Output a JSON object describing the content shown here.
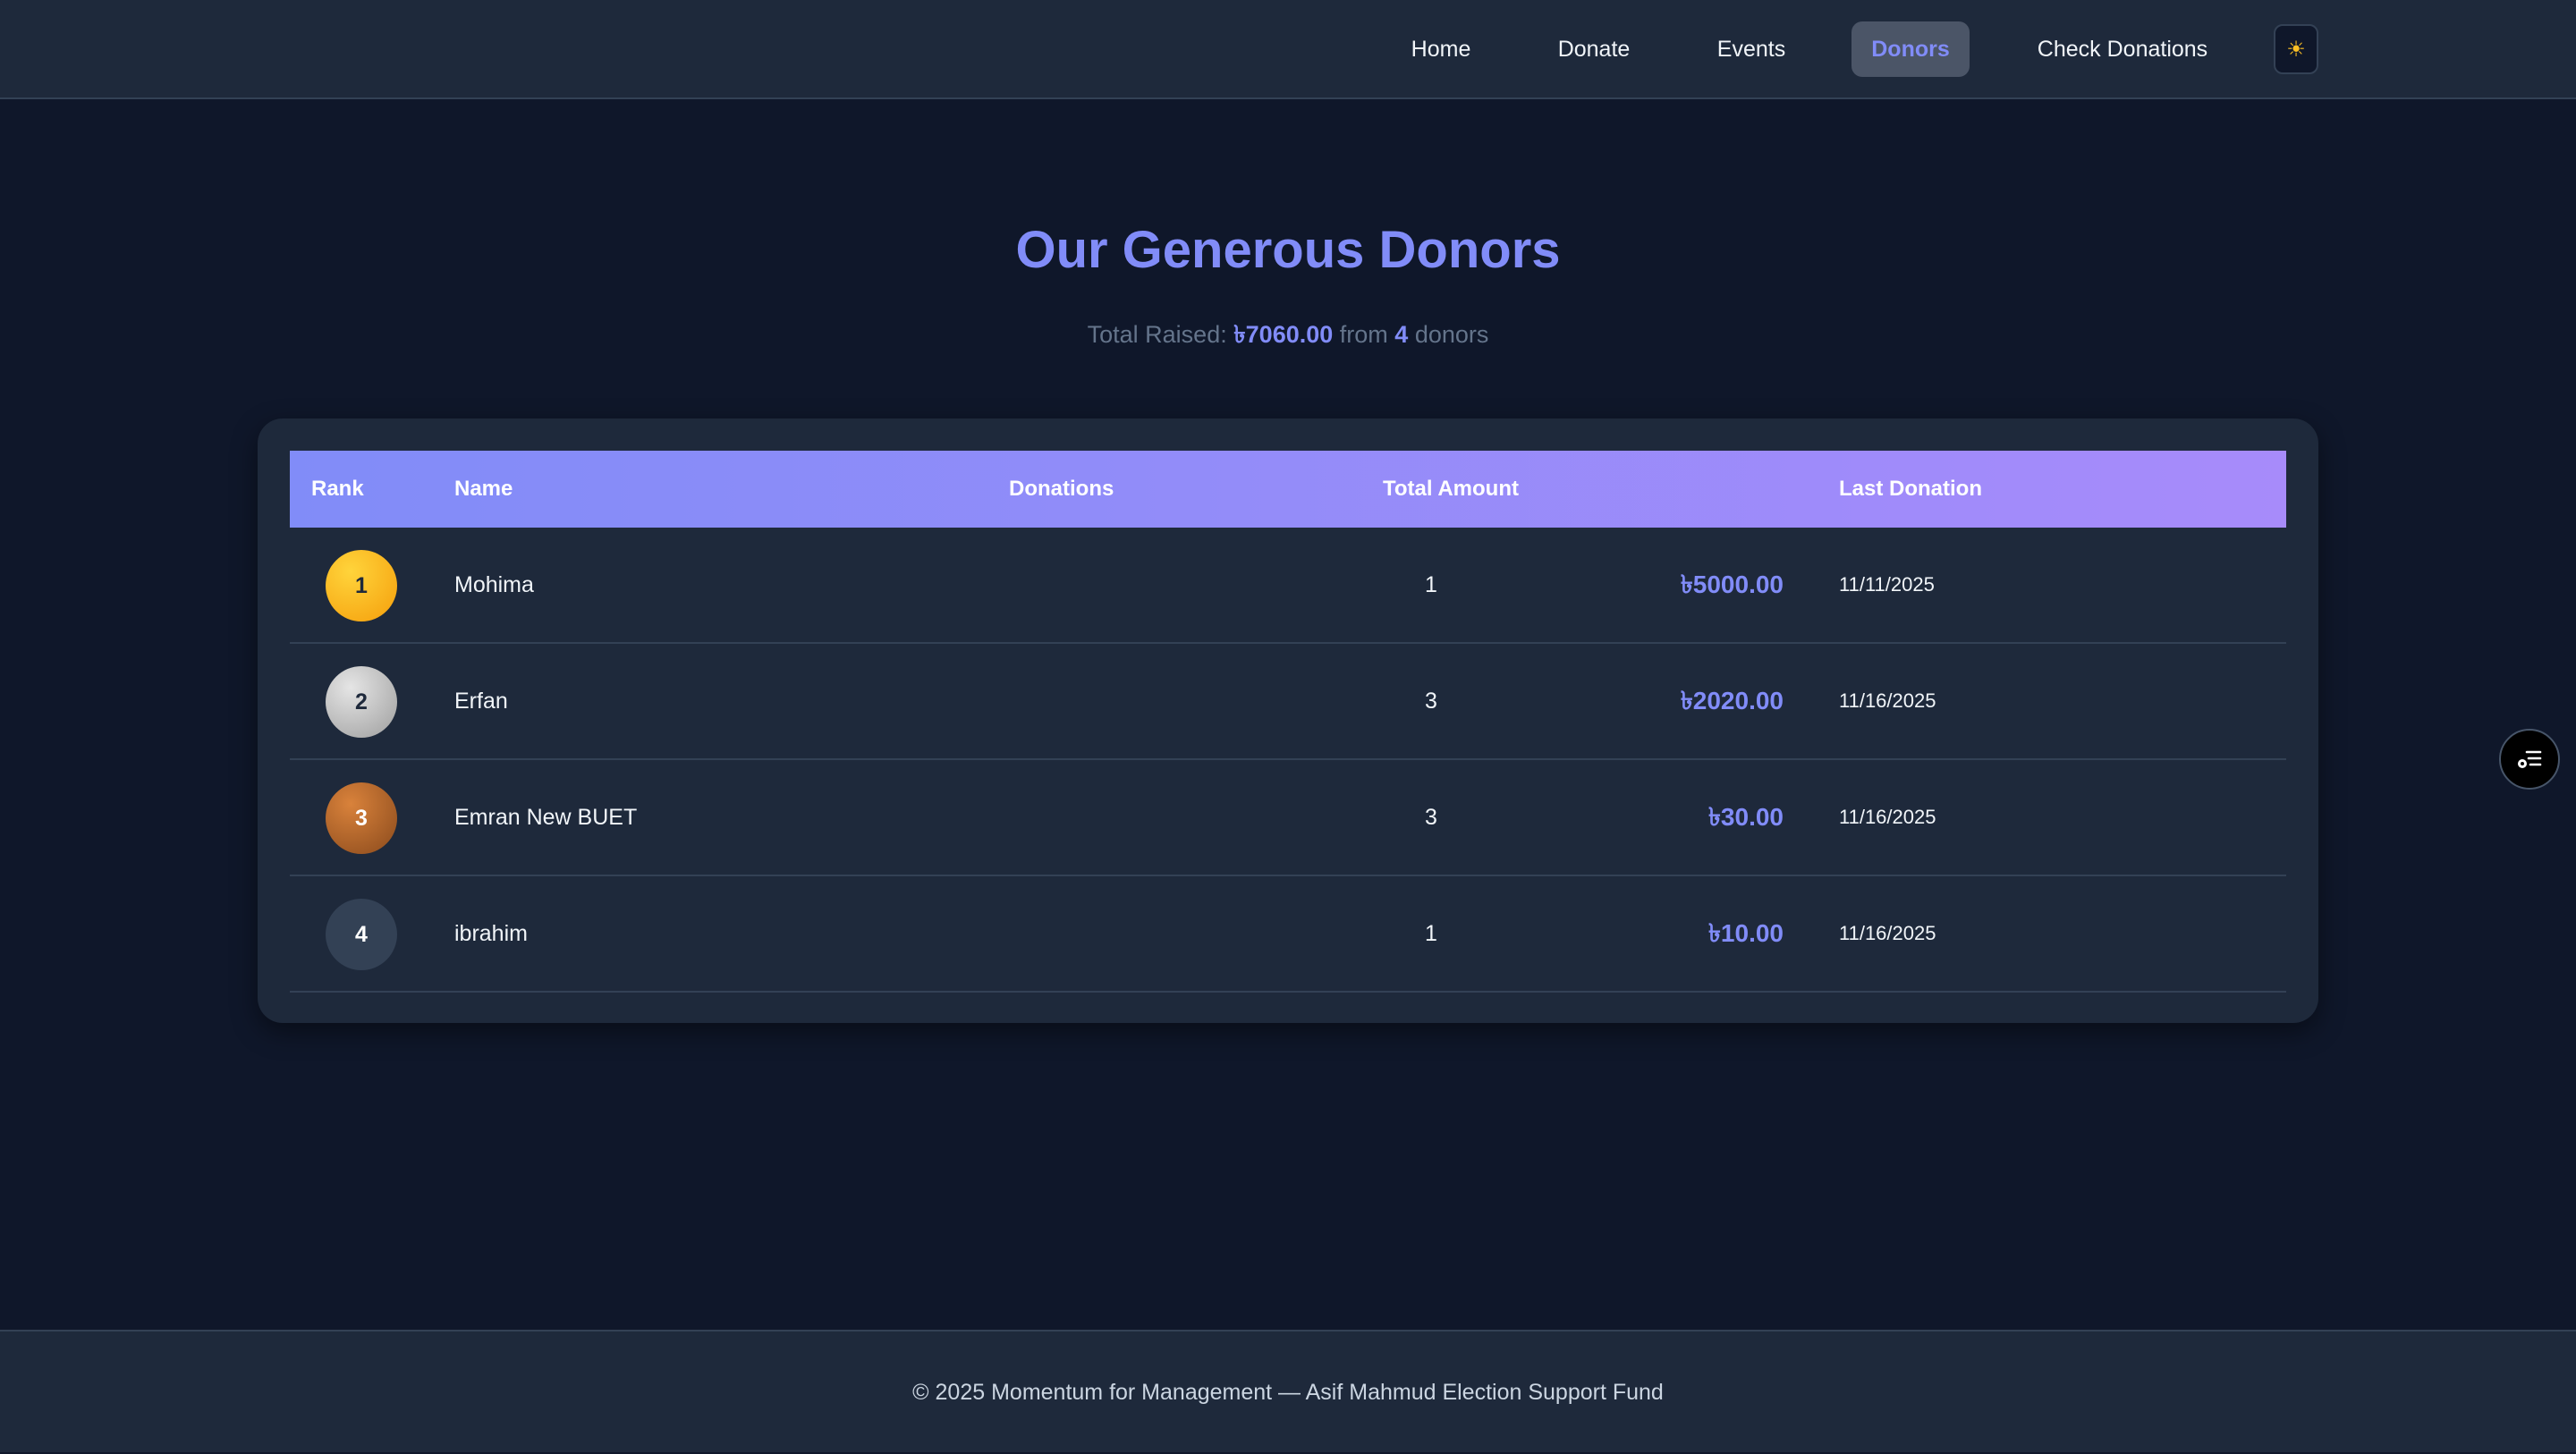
{
  "nav": {
    "items": [
      {
        "label": "Home"
      },
      {
        "label": "Donate"
      },
      {
        "label": "Events"
      },
      {
        "label": "Donors",
        "active": true
      },
      {
        "label": "Check Donations"
      }
    ],
    "theme_toggle_icon": "sun-icon"
  },
  "page": {
    "title": "Our Generous Donors",
    "summary_prefix": "Total Raised: ",
    "total_raised": "৳7060.00",
    "summary_mid": " from ",
    "donor_count": "4",
    "summary_suffix": " donors"
  },
  "table": {
    "columns": [
      "Rank",
      "Name",
      "Donations",
      "Total Amount",
      "Last Donation"
    ],
    "rows": [
      {
        "rank": "1",
        "name": "Mohima",
        "donations": "1",
        "total": "৳5000.00",
        "last": "11/11/2025"
      },
      {
        "rank": "2",
        "name": "Erfan",
        "donations": "3",
        "total": "৳2020.00",
        "last": "11/16/2025"
      },
      {
        "rank": "3",
        "name": "Emran New BUET",
        "donations": "3",
        "total": "৳30.00",
        "last": "11/16/2025"
      },
      {
        "rank": "4",
        "name": "ibrahim",
        "donations": "1",
        "total": "৳10.00",
        "last": "11/16/2025"
      }
    ]
  },
  "colors": {
    "accent": "#818cf8",
    "gold": "#fbbf24",
    "silver": "#bdbdbd",
    "bronze": "#b8692a",
    "default_rank": "#334155"
  },
  "footer": {
    "text": "© 2025 Momentum for Management — Asif Mahmud Election Support Fund"
  },
  "fab": {
    "icon": "list-settings-icon"
  }
}
